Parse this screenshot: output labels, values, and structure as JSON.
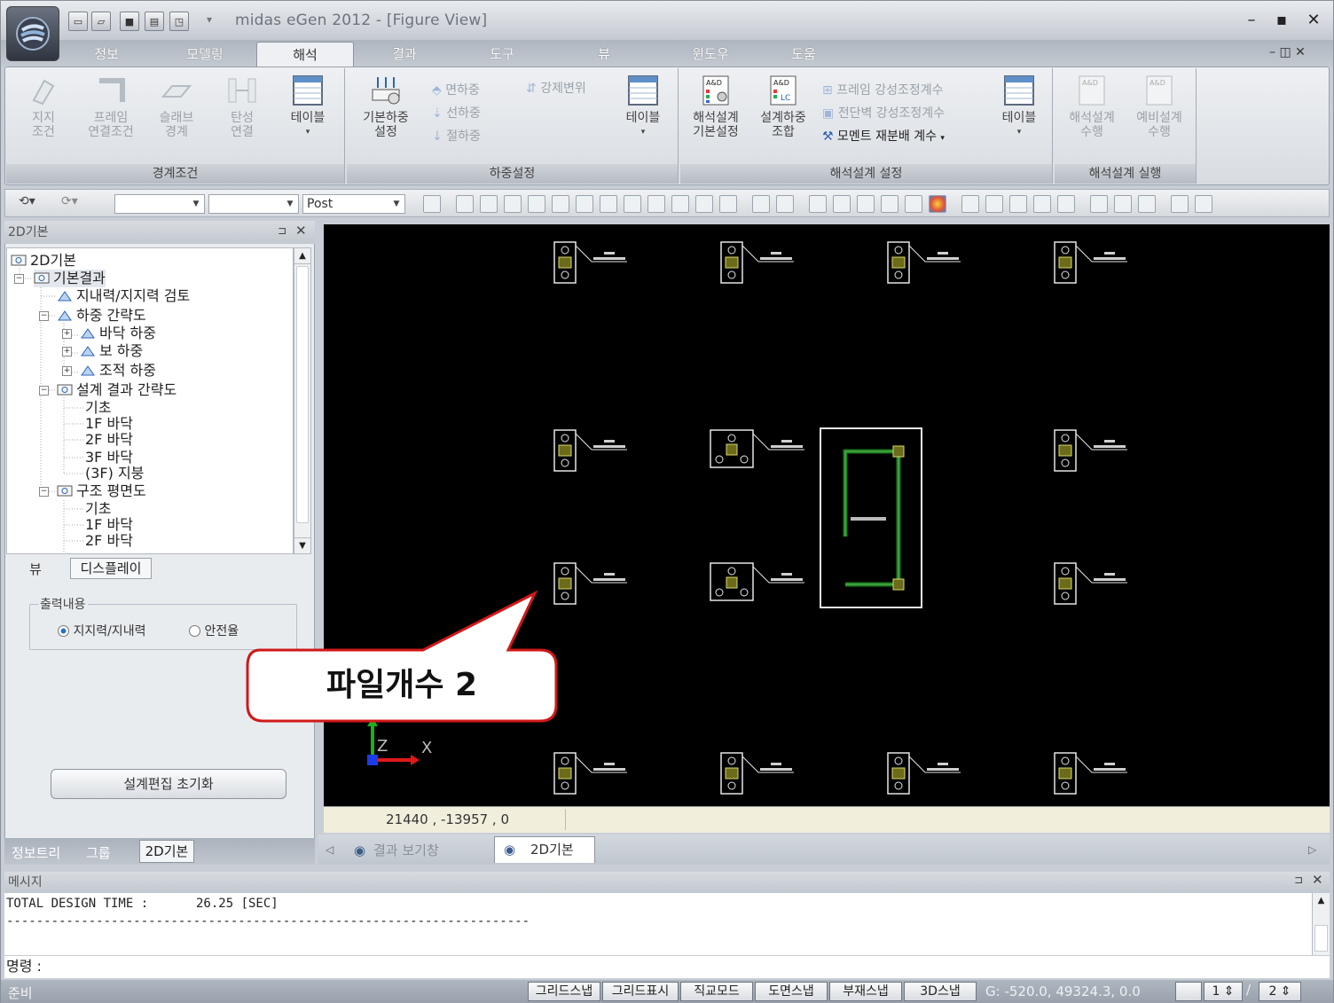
{
  "app": {
    "title": "midas eGen  2012 - [Figure View]"
  },
  "menu_tabs": [
    "정보",
    "모델링",
    "해석",
    "결과",
    "도구",
    "뷰",
    "윈도우",
    "도움"
  ],
  "active_tab": "해석",
  "ribbon": {
    "groups": [
      {
        "label": "경계조건",
        "buttons": [
          {
            "label": "지지\n조건",
            "enabled": false
          },
          {
            "label": "프레임\n연결조건",
            "enabled": false
          },
          {
            "label": "슬래브\n경계",
            "enabled": false
          },
          {
            "label": "탄성\n연결",
            "enabled": false
          },
          {
            "label": "테이블",
            "enabled": true
          }
        ]
      },
      {
        "label": "하중설정",
        "buttons": [
          {
            "label": "기본하중\n설정",
            "enabled": true
          },
          {
            "label": "테이블",
            "enabled": true
          }
        ],
        "small": [
          {
            "label": "면하중",
            "enabled": false
          },
          {
            "label": "선하중",
            "enabled": false
          },
          {
            "label": "절하중",
            "enabled": false
          },
          {
            "label": "강제변위",
            "enabled": false
          }
        ]
      },
      {
        "label": "해석설계 설정",
        "buttons": [
          {
            "label": "해석설계\n기본설정",
            "enabled": true
          },
          {
            "label": "설계하중\n조합",
            "enabled": true
          },
          {
            "label": "테이블",
            "enabled": true
          }
        ],
        "small": [
          {
            "label": "프레임 강성조정계수",
            "enabled": false
          },
          {
            "label": "전단벽 강성조정계수",
            "enabled": false
          },
          {
            "label": "모멘트 재분배 계수",
            "enabled": true
          }
        ]
      },
      {
        "label": "해석설계 실행",
        "buttons": [
          {
            "label": "해석설계\n수행",
            "enabled": false
          },
          {
            "label": "예비설계\n수행",
            "enabled": false
          }
        ]
      }
    ]
  },
  "toolbar": {
    "combo_post": "Post"
  },
  "left_panel": {
    "title": "2D기본",
    "tree": [
      {
        "label": "2D기본",
        "level": 0
      },
      {
        "label": "기본결과",
        "level": 1,
        "expand": "-"
      },
      {
        "label": "지내력/지지력 검토",
        "level": 2
      },
      {
        "label": "하중 간략도",
        "level": 2,
        "expand": "-"
      },
      {
        "label": "바닥 하중",
        "level": 3,
        "expand": "+"
      },
      {
        "label": "보 하중",
        "level": 3,
        "expand": "+"
      },
      {
        "label": "조적 하중",
        "level": 3,
        "expand": "+"
      },
      {
        "label": "설계 결과 간략도",
        "level": 2,
        "expand": "-"
      },
      {
        "label": "기초",
        "level": 3
      },
      {
        "label": "1F 바닥",
        "level": 3
      },
      {
        "label": "2F 바닥",
        "level": 3
      },
      {
        "label": "3F 바닥",
        "level": 3
      },
      {
        "label": "(3F) 지붕",
        "level": 3
      },
      {
        "label": "구조 평면도",
        "level": 2,
        "expand": "-"
      },
      {
        "label": "기초",
        "level": 3
      },
      {
        "label": "1F 바닥",
        "level": 3
      },
      {
        "label": "2F 바닥",
        "level": 3
      }
    ],
    "sub_tabs": [
      "뷰",
      "디스플레이"
    ],
    "output_group_label": "출력내용",
    "radio_options": [
      {
        "label": "지지력/지내력",
        "checked": true
      },
      {
        "label": "안전율",
        "checked": false
      }
    ],
    "reset_button": "설계편집 초기화",
    "bottom_tabs": [
      "정보트리",
      "그룹",
      "2D기본"
    ]
  },
  "canvas": {
    "coord_readout": "21440 , -13957 , 0",
    "axis_z": "Z",
    "axis_x": "X"
  },
  "doc_tabs": [
    "결과 보기창",
    "2D기본"
  ],
  "callout_text": "파일개수 2",
  "message_panel": {
    "title": "메시지",
    "line1_label": "TOTAL DESIGN TIME :",
    "line1_value": "26.25 [SEC]",
    "separator": "-----------------------------------------------------------------------------------------",
    "command_label": "명령 :"
  },
  "status_bar": {
    "ready": "준비",
    "buttons": [
      "그리드스냅",
      "그리드표시",
      "직교모드",
      "도면스냅",
      "부재스냅",
      "3D스냅"
    ],
    "coords": "G: -520.0, 49324.3, 0.0",
    "spin1": "1",
    "spin2": "2"
  },
  "colors": {
    "canvas_bg": "#000000",
    "callout_border": "#d01818",
    "pile_fill": "#6b6b1a",
    "wall_green": "#1e7a1e"
  }
}
